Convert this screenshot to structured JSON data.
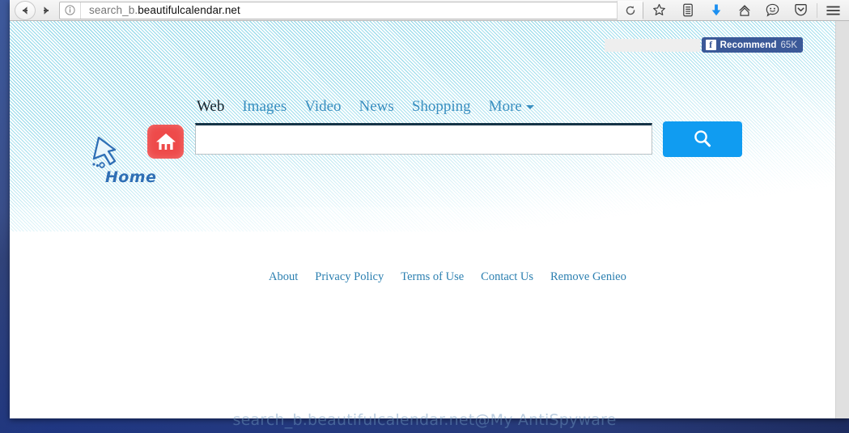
{
  "browser": {
    "back_icon": "back-arrow-icon",
    "forward_icon": "forward-arrow-icon",
    "identity_icon": "info-icon",
    "url": "search_b.beautifulcalendar.net",
    "url_prefix": "search_b.",
    "url_host": "beautifulcalendar.net",
    "reload_icon": "reload-icon",
    "toolbar_icons": [
      {
        "name": "bookmark-star-icon",
        "glyph": "star"
      },
      {
        "name": "library-icon",
        "glyph": "library"
      },
      {
        "name": "downloads-icon",
        "glyph": "download-arrow"
      },
      {
        "name": "home-icon",
        "glyph": "home"
      },
      {
        "name": "feedback-smiley-icon",
        "glyph": "smiley"
      },
      {
        "name": "pocket-icon",
        "glyph": "shield"
      },
      {
        "name": "menu-icon",
        "glyph": "hamburger"
      }
    ]
  },
  "social": {
    "fb_icon_letter": "f",
    "recommend_label": "Recommend",
    "recommend_count": "65K"
  },
  "site_nav": {
    "items": [
      {
        "label": "Web",
        "active": true
      },
      {
        "label": "Images",
        "active": false
      },
      {
        "label": "Video",
        "active": false
      },
      {
        "label": "News",
        "active": false
      },
      {
        "label": "Shopping",
        "active": false
      },
      {
        "label": "More",
        "active": false
      }
    ]
  },
  "logo": {
    "word": "Home",
    "cursor_icon": "cursor-arrow-icon",
    "house_icon": "house-icon",
    "house_color": "#ee4a4a"
  },
  "search": {
    "value": "",
    "placeholder": "",
    "button_icon": "search-magnifier-icon",
    "button_color": "#109cf1"
  },
  "footer": {
    "links": [
      {
        "label": "About"
      },
      {
        "label": "Privacy Policy"
      },
      {
        "label": "Terms of Use"
      },
      {
        "label": "Contact Us"
      },
      {
        "label": "Remove Genieo"
      }
    ]
  },
  "watermark": {
    "text": "search_b.beautifulcalendar.net@My AntiSpyware"
  },
  "colors": {
    "accent_blue": "#109cf1",
    "nav_link": "#3a8fc0",
    "facebook_blue": "#3b5998",
    "texture_cyan": "#56c4de"
  }
}
